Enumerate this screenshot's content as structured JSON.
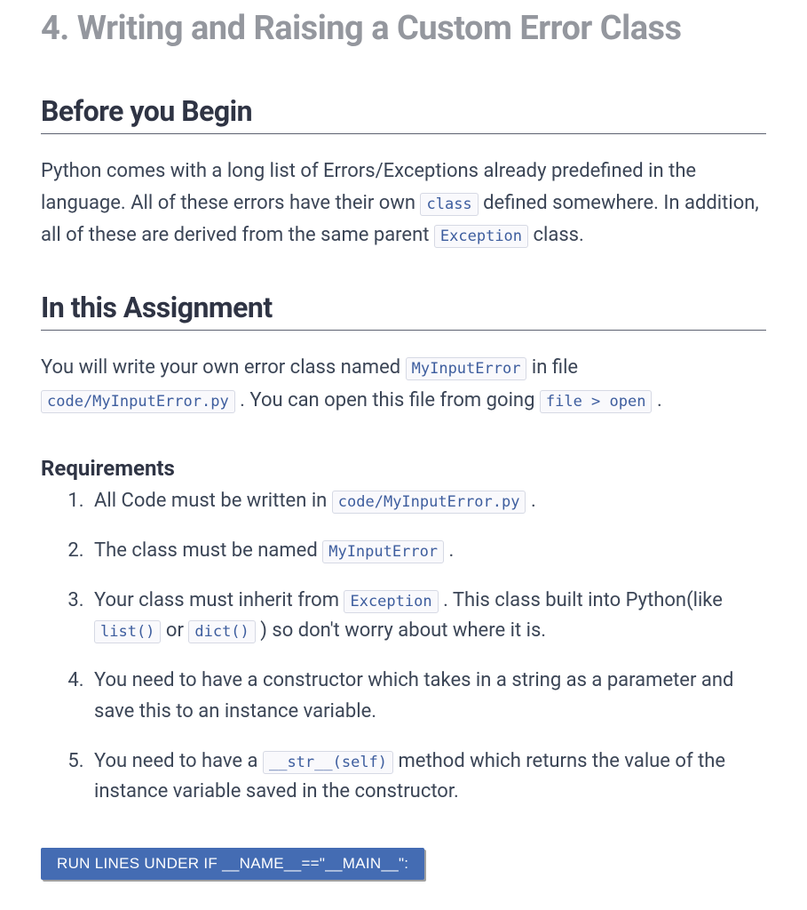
{
  "title": "4. Writing and Raising a Custom Error Class",
  "sections": {
    "before": {
      "heading": "Before you Begin",
      "p1a": "Python comes with a long list of Errors/Exceptions already predefined in the language. All of these errors have their own ",
      "code1": "class",
      "p1b": " defined somewhere. In addition, all of these are derived from the same parent ",
      "code2": "Exception",
      "p1c": " class."
    },
    "assignment": {
      "heading": "In this Assignment",
      "p1a": "You will write your own error class named ",
      "code1": "MyInputError",
      "p1b": " in file ",
      "code2": "code/MyInputError.py",
      "p1c": ". You can open this file from going ",
      "code3": "file > open",
      "p1d": "."
    },
    "requirements": {
      "heading": "Requirements",
      "items": {
        "i1a": "All Code must be written in ",
        "i1code": "code/MyInputError.py",
        "i1b": ".",
        "i2a": "The class must be named ",
        "i2code": "MyInputError",
        "i2b": ".",
        "i3a": "Your class must inherit from ",
        "i3code1": "Exception",
        "i3b": ". This class built into Python(like ",
        "i3code2": "list()",
        "i3c": " or ",
        "i3code3": "dict()",
        "i3d": ") so don't worry about where it is.",
        "i4": "You need to have a constructor which takes in a string as a parameter and save this to an instance variable.",
        "i5a": "You need to have a ",
        "i5code": "__str__(self)",
        "i5b": " method which returns the value of the instance variable saved in the constructor."
      }
    }
  },
  "button": "RUN LINES UNDER IF __NAME__==\"__MAIN__\":"
}
